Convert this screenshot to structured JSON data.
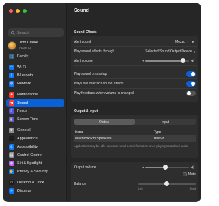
{
  "search": {
    "placeholder": "Search"
  },
  "user": {
    "name": "Tom Clarke",
    "subtitle": "Apple ID"
  },
  "sidebar": {
    "items": [
      {
        "label": "Family",
        "icon": "family-icon",
        "color": "#5b5b5b",
        "glyph": "👥"
      },
      {
        "label": "Wi-Fi",
        "icon": "wifi-icon",
        "color": "#0a7aff",
        "glyph": "◠"
      },
      {
        "label": "Bluetooth",
        "icon": "bluetooth-icon",
        "color": "#0a7aff",
        "glyph": "ᛒ"
      },
      {
        "label": "Network",
        "icon": "network-icon",
        "color": "#0a7aff",
        "glyph": "◍"
      },
      {
        "label": "Notifications",
        "icon": "notifications-icon",
        "color": "#ff3b30",
        "glyph": "■"
      },
      {
        "label": "Sound",
        "icon": "sound-icon",
        "color": "#ff3b30",
        "glyph": "◀"
      },
      {
        "label": "Focus",
        "icon": "focus-icon",
        "color": "#5856d6",
        "glyph": "☾"
      },
      {
        "label": "Screen Time",
        "icon": "screen-time-icon",
        "color": "#5856d6",
        "glyph": "⌛"
      },
      {
        "label": "General",
        "icon": "general-icon",
        "color": "#8e8e93",
        "glyph": "⚙"
      },
      {
        "label": "Appearance",
        "icon": "appearance-icon",
        "color": "#1c1c1e",
        "glyph": "◑"
      },
      {
        "label": "Accessibility",
        "icon": "accessibility-icon",
        "color": "#0a7aff",
        "glyph": "♿"
      },
      {
        "label": "Control Centre",
        "icon": "control-centre-icon",
        "color": "#8e8e93",
        "glyph": "▤"
      },
      {
        "label": "Siri & Spotlight",
        "icon": "siri-icon",
        "color": "#bf5af2",
        "glyph": "◉"
      },
      {
        "label": "Privacy & Security",
        "icon": "privacy-icon",
        "color": "#0a7aff",
        "glyph": "✋"
      },
      {
        "label": "Desktop & Dock",
        "icon": "desktop-dock-icon",
        "color": "#1c1c1e",
        "glyph": "▭"
      },
      {
        "label": "Displays",
        "icon": "displays-icon",
        "color": "#0a7aff",
        "glyph": "☀"
      }
    ],
    "selected": "Sound"
  },
  "main": {
    "title": "Sound",
    "sound_effects_header": "Sound Effects",
    "alert_sound": {
      "label": "Alert sound",
      "value": "Mezzo"
    },
    "play_through": {
      "label": "Play sound effects through",
      "value": "Selected Sound Output Device"
    },
    "alert_volume": {
      "label": "Alert volume",
      "level": 0.92
    },
    "startup": {
      "label": "Play sound on startup",
      "on": true
    },
    "ui_effects": {
      "label": "Play user interface sound effects",
      "on": true
    },
    "feedback": {
      "label": "Play feedback when volume is changed",
      "on": false
    },
    "output_input_header": "Output & Input",
    "tabs": [
      "Output",
      "Input"
    ],
    "table": {
      "headers": [
        "Name",
        "Type"
      ],
      "rows": [
        {
          "name": "MacBook Pro Speakers",
          "type": "Built-in"
        }
      ],
      "note": "Applications may be able to access head pose information when playing spatialised audio."
    },
    "output_volume": {
      "label": "Output volume",
      "level": 0.45
    },
    "mute": {
      "label": "Mute"
    },
    "balance": {
      "label": "Balance",
      "left": "Left",
      "right": "Right"
    }
  },
  "colors": {
    "accent": "#0a60d6",
    "background": "#262626",
    "sidebar": "#2b2b2c"
  }
}
